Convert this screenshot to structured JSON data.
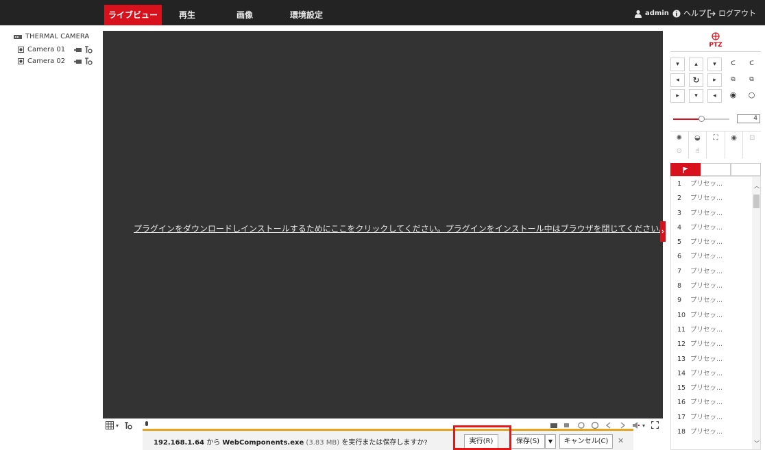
{
  "nav": {
    "tabs": [
      {
        "label": "ライブビュー"
      },
      {
        "label": "再生"
      },
      {
        "label": "画像"
      },
      {
        "label": "環境設定"
      }
    ],
    "user": "admin",
    "help": "ヘルプ",
    "logout": "ログアウト"
  },
  "tree": {
    "root": "THERMAL CAMERA",
    "cameras": [
      {
        "label": "Camera 01"
      },
      {
        "label": "Camera 02"
      }
    ]
  },
  "video": {
    "plugin_message": "プラグインをダウンロードしインストールするためにここをクリックしてください。プラグインをインストール中はブラウザを閉じてください。"
  },
  "download_bar": {
    "host": "192.168.1.64",
    "from": " から ",
    "file": "WebComponents.exe",
    "size": " (3.83 MB) ",
    "question": "を実行または保存しますか?",
    "run": "実行(R)",
    "save": "保存(S)",
    "cancel": "キャンセル(C)"
  },
  "ptz": {
    "title": "PTZ",
    "speed": "4",
    "speed_fraction": 0.5,
    "preset_tab_icon": "flag-icon",
    "presets": [
      {
        "num": "1",
        "name": "プリセッ..."
      },
      {
        "num": "2",
        "name": "プリセッ..."
      },
      {
        "num": "3",
        "name": "プリセッ..."
      },
      {
        "num": "4",
        "name": "プリセッ..."
      },
      {
        "num": "5",
        "name": "プリセッ..."
      },
      {
        "num": "6",
        "name": "プリセッ..."
      },
      {
        "num": "7",
        "name": "プリセッ..."
      },
      {
        "num": "8",
        "name": "プリセッ..."
      },
      {
        "num": "9",
        "name": "プリセッ..."
      },
      {
        "num": "10",
        "name": "プリセッ..."
      },
      {
        "num": "11",
        "name": "プリセッ..."
      },
      {
        "num": "12",
        "name": "プリセッ..."
      },
      {
        "num": "13",
        "name": "プリセッ..."
      },
      {
        "num": "14",
        "name": "プリセッ..."
      },
      {
        "num": "15",
        "name": "プリセッ..."
      },
      {
        "num": "16",
        "name": "プリセッ..."
      },
      {
        "num": "17",
        "name": "プリセッ..."
      },
      {
        "num": "18",
        "name": "プリセッ..."
      }
    ]
  },
  "colors": {
    "accent": "#d7121c",
    "nav_bg": "#232323",
    "video_bg": "#333333",
    "download_border": "#e8a31c"
  }
}
